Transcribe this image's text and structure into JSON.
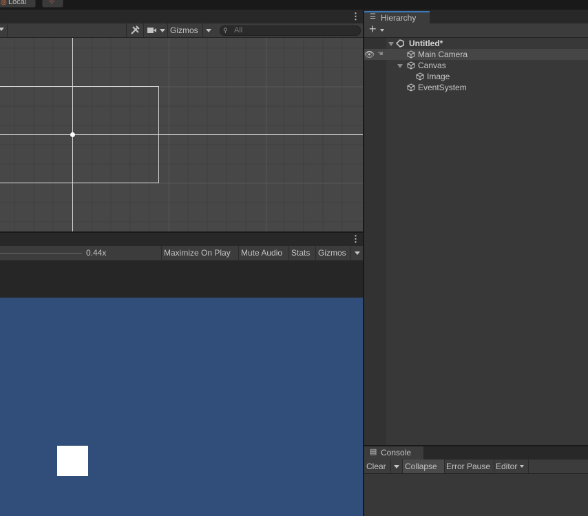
{
  "topbar": {
    "pivot_label": "Local"
  },
  "scene": {
    "gizmos_label": "Gizmos",
    "search_placeholder": "All"
  },
  "game": {
    "scale_value": "0.44x",
    "maximize_label": "Maximize On Play",
    "mute_label": "Mute Audio",
    "stats_label": "Stats",
    "gizmos_label": "Gizmos",
    "background_color": "#314d79"
  },
  "hierarchy": {
    "tab_label": "Hierarchy",
    "scene_name": "Untitled*",
    "items": [
      {
        "label": "Main Camera"
      },
      {
        "label": "Canvas"
      },
      {
        "label": "Image"
      },
      {
        "label": "EventSystem"
      }
    ]
  },
  "console": {
    "tab_label": "Console",
    "clear_label": "Clear",
    "collapse_label": "Collapse",
    "error_pause_label": "Error Pause",
    "editor_label": "Editor"
  },
  "colors": {
    "accent": "#3a79bb",
    "panel": "#383838",
    "toolbar": "#3c3c3c"
  }
}
